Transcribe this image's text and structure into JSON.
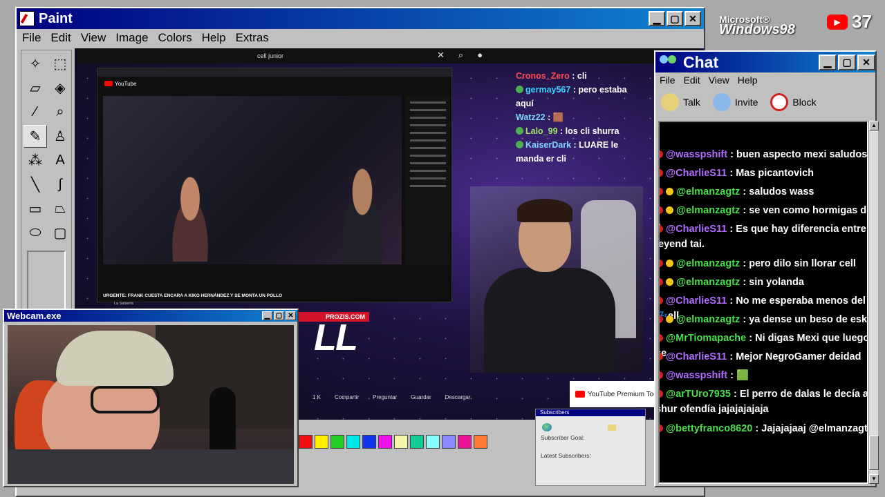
{
  "paint": {
    "title": "Paint",
    "menu": [
      "File",
      "Edit",
      "View",
      "Image",
      "Colors",
      "Help",
      "Extras"
    ],
    "palette": [
      "#ee1111",
      "#ffee00",
      "#22cc22",
      "#00e6e6",
      "#1133ee",
      "#ee11ee",
      "#f5f5aa",
      "#11cc99",
      "#88ffff",
      "#8888ff",
      "#ee1199",
      "#ff7733"
    ]
  },
  "stream": {
    "search_query": "cell junior",
    "inner_caption": "URGENTE: FRANK CUESTA ENCARA A KIKO HERNÁNDEZ Y SE MONTA UN POLLO",
    "inner_channel": "La Salsería",
    "promo": "PROZIS.COM",
    "big_text": "LL",
    "actions": [
      "1 K",
      "Compartir",
      "Preguntar",
      "Guardar",
      "Descargar"
    ],
    "premium": "YouTube Premium  Todo Y",
    "chat": [
      {
        "user": "Cronos_Zero",
        "text": "cli"
      },
      {
        "user": "germay567",
        "text": "pero estaba aquí"
      },
      {
        "user": "Watz22",
        "text": "🟫"
      },
      {
        "user": "Lalo_99",
        "text": "los cli shurra"
      },
      {
        "user": "KaiserDark",
        "text": "LUARE le manda er cli"
      }
    ]
  },
  "subs": {
    "title": "Subscribers",
    "goal": "Subscriber Goal:",
    "latest": "Latest Subscribers:"
  },
  "webcam": {
    "title": "Webcam.exe"
  },
  "chat": {
    "title": "Chat",
    "menu": [
      "File",
      "Edit",
      "View",
      "Help"
    ],
    "toolbar": [
      "Talk",
      "Invite",
      "Block"
    ],
    "messages": [
      {
        "user": "@wasspshift",
        "color": "#b06bff",
        "badge": false,
        "text": "buen aspecto mexi saludos tais"
      },
      {
        "user": "@CharlieS11",
        "color": "#b06bff",
        "badge": false,
        "text": "Mas picantovich"
      },
      {
        "user": "@elmanzagtz",
        "color": "#4ade4a",
        "badge": true,
        "text": "saludos wass"
      },
      {
        "user": "@elmanzagtz",
        "color": "#4ade4a",
        "badge": true,
        "text": "se ven como hormigas desde a"
      },
      {
        "user": "@CharlieS11",
        "color": "#b06bff",
        "badge": false,
        "text": "Es que hay diferencia entre leyend tai."
      },
      {
        "user": "@elmanzagtz",
        "color": "#4ade4a",
        "badge": true,
        "text": "pero dilo sin llorar cell"
      },
      {
        "user": "@elmanzagtz",
        "color": "#4ade4a",
        "badge": true,
        "text": "sin yolanda"
      },
      {
        "user": "@CharlieS11",
        "color": "#b06bff",
        "badge": false,
        "text": "No me esperaba menos del 💤ell"
      },
      {
        "user": "@elmanzagtz",
        "color": "#4ade4a",
        "badge": true,
        "text": "ya dense un beso de eskimal"
      },
      {
        "user": "@MrTiomapache",
        "color": "#4ade4a",
        "badge": false,
        "text": "Ni digas Mexi que luego si se"
      },
      {
        "user": "@CharlieS11",
        "color": "#b06bff",
        "badge": false,
        "text": "Mejor NegroGamer deidad"
      },
      {
        "user": "@wasspshift",
        "color": "#b06bff",
        "badge": false,
        "text": "🟩"
      },
      {
        "user": "@arTUro7935",
        "color": "#4ade4a",
        "badge": false,
        "text": "El perro de dalas le decía al shur ofendía jajajajajaja"
      },
      {
        "user": "@bettyfranco8620",
        "color": "#4ade4a",
        "badge": false,
        "text": "Jajajajaaj @elmanzagtz 😂"
      }
    ]
  },
  "overlay": {
    "brand_top": "Microsoft®",
    "brand": "Windows98",
    "yt_count": "37"
  }
}
